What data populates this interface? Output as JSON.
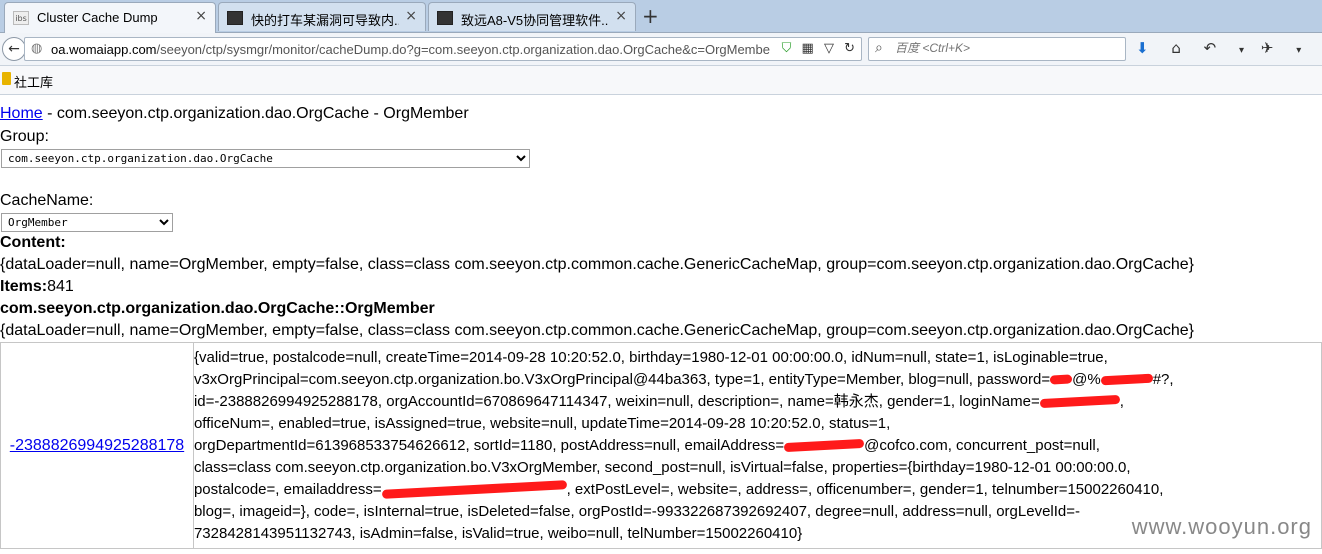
{
  "browser": {
    "tabs": [
      {
        "title": "Cluster Cache Dump",
        "favicon": "ibs"
      },
      {
        "title": "快的打车某漏洞可导致内...",
        "favicon": ""
      },
      {
        "title": "致远A8-V5协同管理软件...",
        "favicon": ""
      }
    ],
    "close_glyph": "×",
    "new_tab_glyph": "+",
    "url_host": "oa.womaiapp.com",
    "url_path": "/seeyon/ctp/sysmgr/monitor/cacheDump.do?g=com.seeyon.ctp.organization.dao.OrgCache&c=OrgMembe",
    "search_placeholder": "百度 <Ctrl+K>",
    "bookmark": "社工库",
    "watermark": "www.wooyun.org"
  },
  "page": {
    "breadcrumb_home": "Home",
    "breadcrumb_rest": " - com.seeyon.ctp.organization.dao.OrgCache - OrgMember",
    "group_label": "Group:",
    "group_value": "com.seeyon.ctp.organization.dao.OrgCache",
    "cachename_label": "CacheName:",
    "cachename_value": "OrgMember",
    "content_label": "Content:",
    "content_text": "{dataLoader=null, name=OrgMember, empty=false, class=class com.seeyon.ctp.common.cache.GenericCacheMap, group=com.seeyon.ctp.organization.dao.OrgCache}",
    "items_label": "Items:",
    "items_count": "841",
    "section_title": "com.seeyon.ctp.organization.dao.OrgCache::OrgMember",
    "section_text": "{dataLoader=null, name=OrgMember, empty=false, class=class com.seeyon.ctp.common.cache.GenericCacheMap, group=com.seeyon.ctp.organization.dao.OrgCache}",
    "row_key": "-2388826994925288178",
    "row_lines": {
      "l1": "{valid=true, postalcode=null, createTime=2014-09-28 10:20:52.0, birthday=1980-12-01 00:00:00.0, idNum=null, state=1, isLoginable=true,",
      "l2": "v3xOrgPrincipal=com.seeyon.ctp.organization.bo.V3xOrgPrincipal@44ba363, type=1, entityType=Member, blog=null, password=",
      "l2b": "@%",
      "l2c": "#?,",
      "l3a": "id=-2388826994925288178, orgAccountId=670869647114347, weixin=null, description=, name=韩永杰, gender=1, loginName=",
      "l3b": ",",
      "l4": "officeNum=, enabled=true, isAssigned=true, website=null, updateTime=2014-09-28 10:20:52.0, status=1,",
      "l5a": "orgDepartmentId=613968533754626612, sortId=1180, postAddress=null, emailAddress=",
      "l5b": "@cofco.com, concurrent_post=null,",
      "l6": "class=class com.seeyon.ctp.organization.bo.V3xOrgMember, second_post=null, isVirtual=false, properties={birthday=1980-12-01 00:00:00.0,",
      "l7a": "postalcode=, emailaddress=",
      "l7b": ", extPostLevel=, website=, address=, officenumber=, gender=1, telnumber=15002260410,",
      "l8": "blog=, imageid=}, code=, isInternal=true, isDeleted=false, orgPostId=-993322687392692407, degree=null, address=null, orgLevelId=-",
      "l9": "7328428143951132743, isAdmin=false, isValid=true, weibo=null, telNumber=15002260410}"
    }
  }
}
